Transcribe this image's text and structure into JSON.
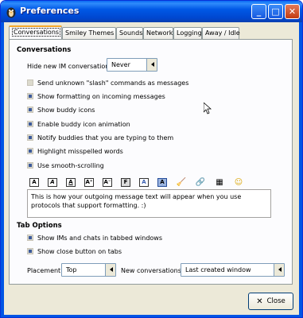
{
  "window": {
    "title": "Preferences",
    "controls": {
      "minimize": "_",
      "maximize": "□",
      "close": "✕"
    }
  },
  "tabs": [
    {
      "label": "Conversations",
      "active": true
    },
    {
      "label": "Smiley Themes"
    },
    {
      "label": "Sounds"
    },
    {
      "label": "Network"
    },
    {
      "label": "Logging"
    },
    {
      "label": "Away / Idle"
    }
  ],
  "conversations": {
    "section_title": "Conversations",
    "hide_label": "Hide new IM conversations",
    "hide_value": "Never",
    "options": [
      {
        "label": "Send unknown \"slash\" commands as messages",
        "checked": false
      },
      {
        "label": "Show formatting on incoming messages",
        "checked": true
      },
      {
        "label": "Show buddy icons",
        "checked": true
      },
      {
        "label": "Enable buddy icon animation",
        "checked": true
      },
      {
        "label": "Notify buddies that you are typing to them",
        "checked": true
      },
      {
        "label": "Highlight misspelled words",
        "checked": true
      },
      {
        "label": "Use smooth-scrolling",
        "checked": true
      }
    ],
    "toolbar_icons": [
      "bold-icon",
      "italic-icon",
      "underline-icon",
      "increase-font-icon",
      "decrease-font-icon",
      "font-face-icon",
      "foreground-color-icon",
      "background-color-icon",
      "clear-formatting-icon",
      "insert-link-icon",
      "insert-image-icon",
      "insert-smiley-icon"
    ],
    "preview_text": "This is how your outgoing message text will appear when you use protocols that support formatting. :)"
  },
  "tab_options": {
    "section_title": "Tab Options",
    "options": [
      {
        "label": "Show IMs and chats in tabbed windows",
        "checked": true
      },
      {
        "label": "Show close button on tabs",
        "checked": true
      }
    ],
    "placement_label": "Placement:",
    "placement_value": "Top",
    "new_conv_label": "New conversations:",
    "new_conv_value": "Last created window"
  },
  "footer": {
    "close_label": "Close"
  }
}
